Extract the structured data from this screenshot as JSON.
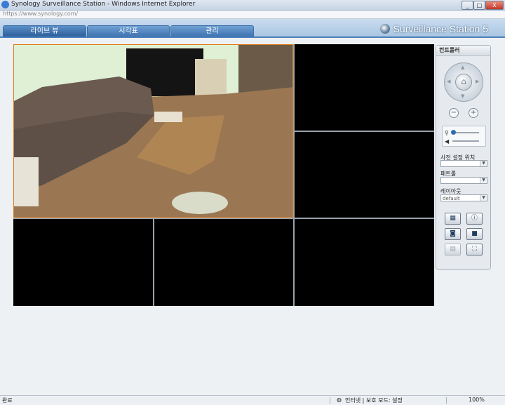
{
  "window": {
    "title": "Synology Surveillance Station - Windows Internet Explorer",
    "address": "https://www.synology.com/",
    "buttons": [
      "_",
      "□",
      "X"
    ]
  },
  "tabs": [
    {
      "label": "라이브 뷰",
      "active": true
    },
    {
      "label": "시각표",
      "active": false
    },
    {
      "label": "관리",
      "active": false
    }
  ],
  "brand": {
    "name": "Surveillance Station 5"
  },
  "controller": {
    "title": "컨트롤러",
    "zoom_out": "−",
    "zoom_in": "+",
    "preset_label": "사전 설정 위치",
    "preset_value": "",
    "patrol_label": "패트롤",
    "patrol_value": "",
    "layout_label": "레이아웃",
    "layout_value": "default"
  },
  "status": {
    "left": "완료",
    "zone": "인터넷 | 보호 모드: 설정",
    "zoom": "100%"
  },
  "colors": {
    "accent": "#3f74b1",
    "camera_border": "#e07a14"
  }
}
